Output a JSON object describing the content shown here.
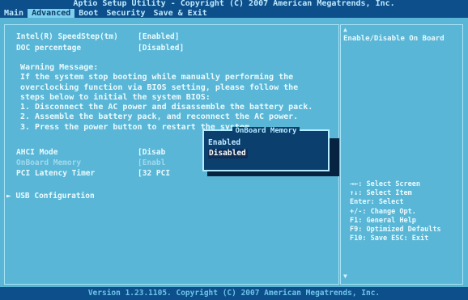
{
  "title": "Aptio Setup Utility - Copyright (C) 2007 American Megatrends, Inc.",
  "tabs": [
    "Main",
    "Advanced",
    "Boot",
    "Security",
    "Save & Exit"
  ],
  "active_tab": "Advanced",
  "settings": [
    {
      "label": "Intel(R) SpeedStep(tm)",
      "value": "[Enabled]"
    },
    {
      "label": "DOC percentage",
      "value": "[Disabled]"
    }
  ],
  "warning": {
    "heading": "Warning Message:",
    "lines": [
      "If the system stop booting while manually performing the",
      "overclocking function via BIOS setting, please follow the",
      "steps below to initial the system BIOS:",
      "1. Disconnect the AC power and disassemble the battery pack.",
      "2. Assemble the battery pack, and reconnect the AC power.",
      "3. Press the power button to restart the system."
    ]
  },
  "lower_settings": [
    {
      "label": "AHCI Mode",
      "value": "[Disab"
    },
    {
      "label": "OnBoard Memory",
      "value": "[Enabl"
    },
    {
      "label": "PCI Latency Timer",
      "value": "[32 PCI"
    }
  ],
  "submenu": "USB Configuration",
  "popup": {
    "title": "OnBoard Memory",
    "options": [
      "Enabled",
      "Disabled"
    ],
    "selected": "Disabled"
  },
  "help_text": "Enable/Disable On Board",
  "keys": [
    "→←: Select Screen",
    "↑↓: Select Item",
    "Enter: Select",
    "+/-: Change Opt.",
    "F1: General Help",
    "F9: Optimized Defaults",
    "F10: Save  ESC: Exit"
  ],
  "footer": "Version 1.23.1105. Copyright (C) 2007 American Megatrends, Inc."
}
